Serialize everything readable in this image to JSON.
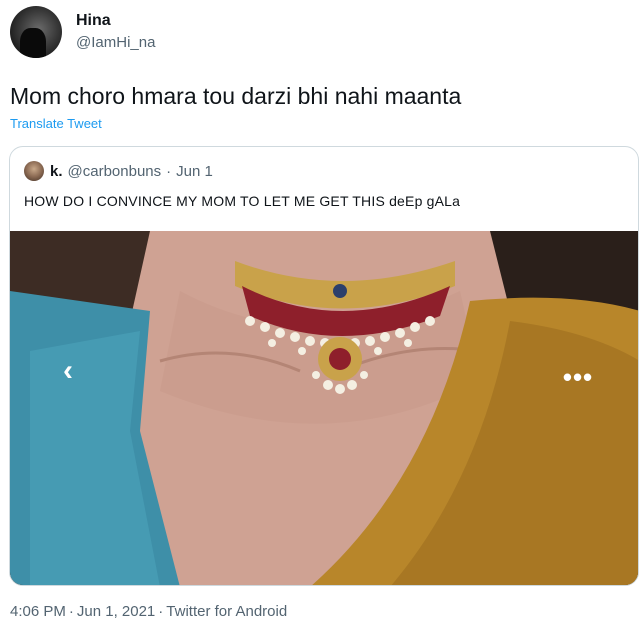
{
  "author": {
    "display_name": "Hina",
    "handle": "@IamHi_na",
    "avatar_icon": "profile-avatar"
  },
  "tweet": {
    "text": "Mom choro hmara tou darzi bhi nahi maanta",
    "translate_label": "Translate Tweet"
  },
  "quoted": {
    "display_name": "k.",
    "handle": "@carbonbuns",
    "separator": "·",
    "date": "Jun 1",
    "text": "HOW DO I CONVINCE MY MOM TO LET ME GET THIS deEp gALa",
    "media": {
      "prev_glyph": "‹",
      "more_glyph": "•••"
    }
  },
  "meta": {
    "time": "4:06 PM",
    "date": "Jun 1, 2021",
    "source": "Twitter for Android",
    "separator": "·"
  },
  "colors": {
    "link": "#1d9bf0",
    "secondary_text": "#536471",
    "border": "#cfd9de"
  }
}
